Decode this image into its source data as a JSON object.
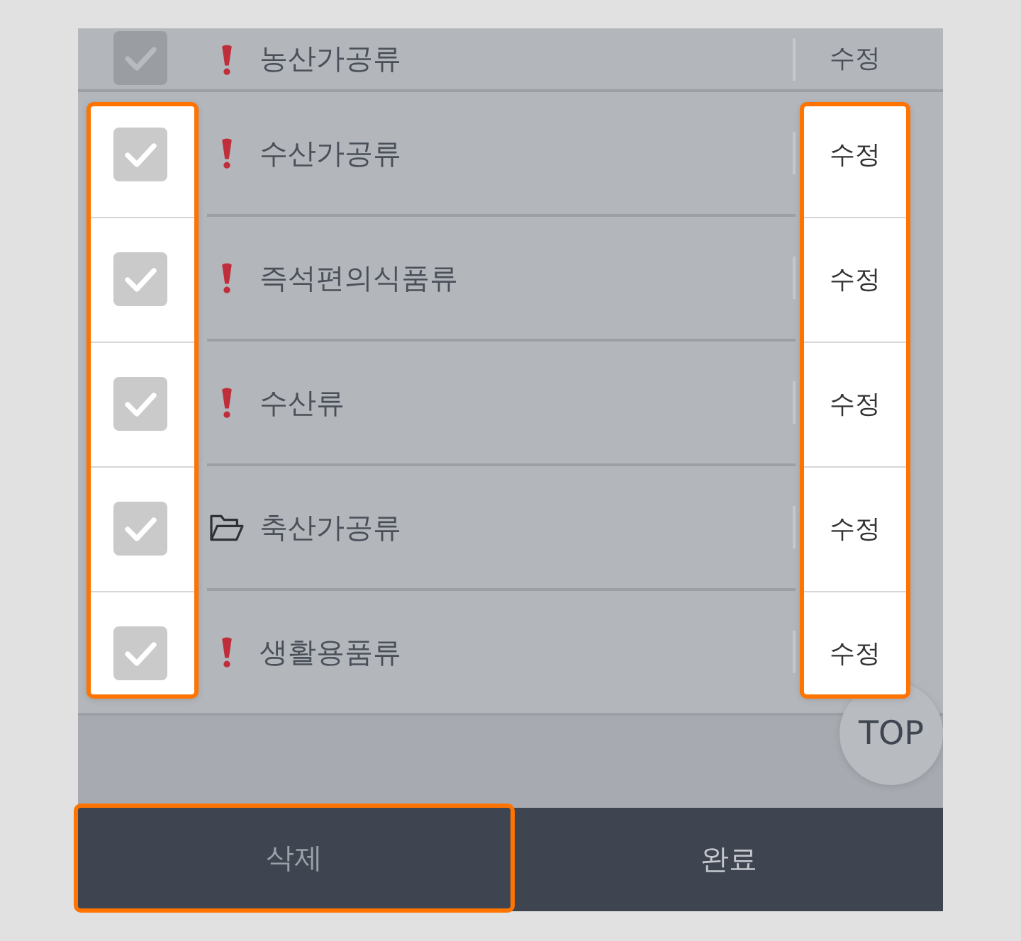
{
  "list": {
    "rows": [
      {
        "kind": "alert",
        "label": "농산가공류",
        "checked": true,
        "highlighted": false,
        "action": "수정"
      },
      {
        "kind": "alert",
        "label": "수산가공류",
        "checked": true,
        "highlighted": true,
        "action": "수정"
      },
      {
        "kind": "alert",
        "label": "즉석편의식품류",
        "checked": true,
        "highlighted": true,
        "action": "수정"
      },
      {
        "kind": "alert",
        "label": "수산류",
        "checked": true,
        "highlighted": true,
        "action": "수정"
      },
      {
        "kind": "folder",
        "label": "축산가공류",
        "checked": true,
        "highlighted": true,
        "action": "수정"
      },
      {
        "kind": "alert",
        "label": "생활용품류",
        "checked": true,
        "highlighted": true,
        "action": "수정"
      }
    ]
  },
  "top_button": {
    "label": "TOP"
  },
  "bottom_bar": {
    "buttons": [
      {
        "label": "삭제",
        "highlighted": true
      },
      {
        "label": "완료",
        "highlighted": false
      }
    ]
  }
}
